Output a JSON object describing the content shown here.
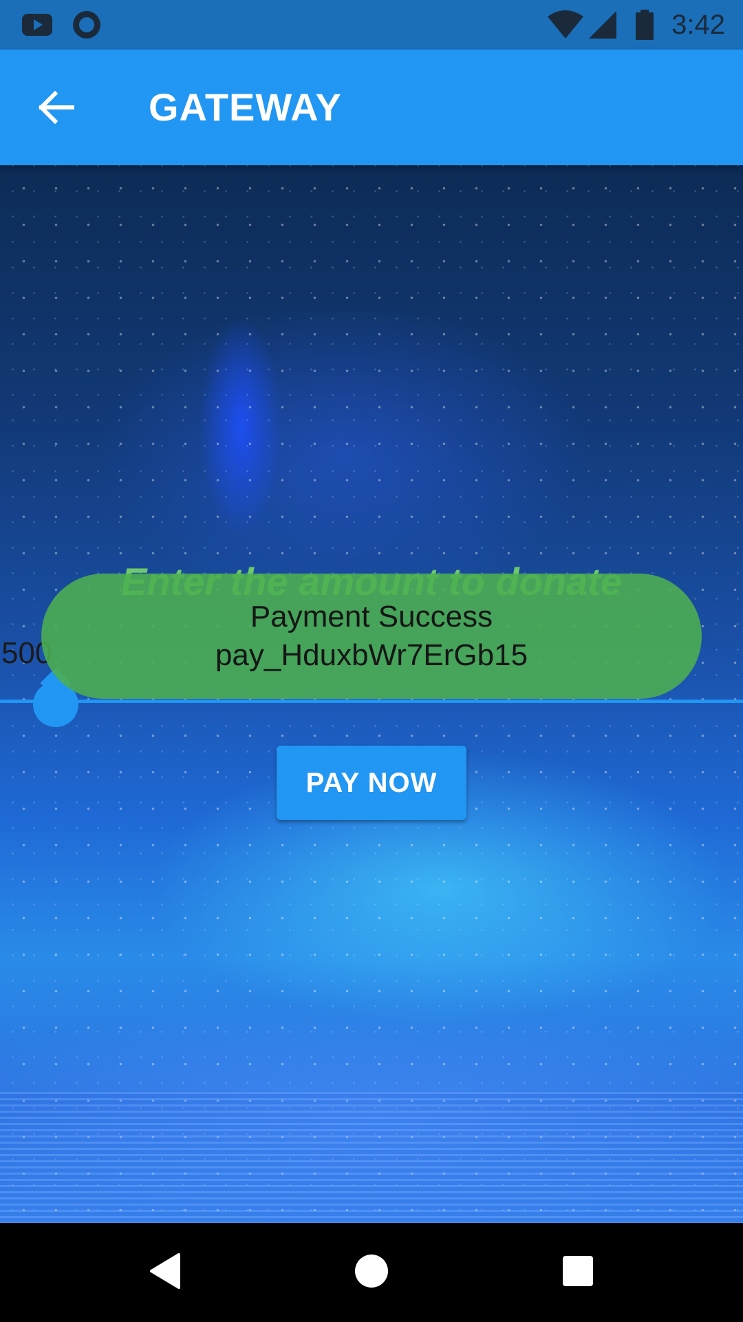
{
  "status_bar": {
    "time": "3:42",
    "left_icons": [
      "youtube-icon",
      "circle-app-icon"
    ],
    "right_icons": [
      "wifi-icon",
      "signal-icon",
      "battery-icon"
    ]
  },
  "app_bar": {
    "back_icon": "arrow-back-icon",
    "title": "GATEWAY"
  },
  "content": {
    "prompt": "Enter the amount to donate",
    "slider": {
      "value_label": "500"
    },
    "toast": {
      "line1": "Payment Success",
      "line2": "pay_HduxbWr7ErGb15"
    },
    "pay_button_label": "PAY NOW"
  },
  "nav_bar": {
    "icons": [
      "back-triangle-icon",
      "home-circle-icon",
      "recents-square-icon"
    ]
  },
  "colors": {
    "primary": "#2196f3",
    "status_bar": "#1a6fb8",
    "toast_green": "#4caf50",
    "prompt_green": "#6ec96e"
  }
}
